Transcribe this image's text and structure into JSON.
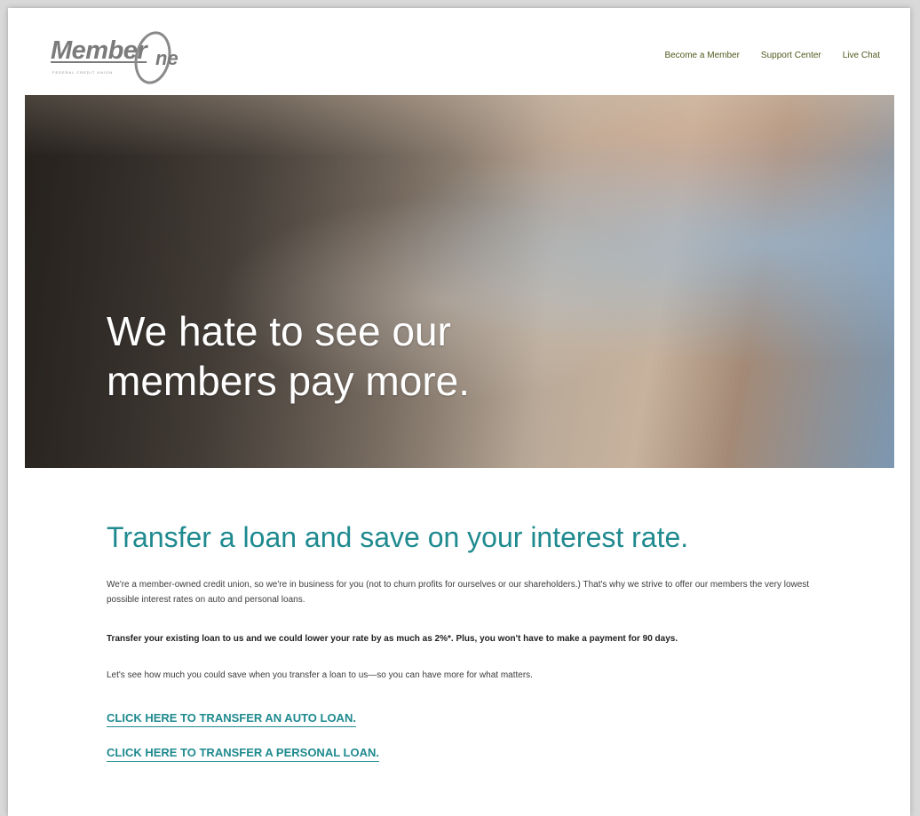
{
  "brand": {
    "logo_word": "Member",
    "logo_one": "ne",
    "logo_sub": "FEDERAL CREDIT UNION"
  },
  "nav": {
    "items": [
      {
        "label": "Become a Member"
      },
      {
        "label": "Support Center"
      },
      {
        "label": "Live Chat"
      }
    ]
  },
  "hero": {
    "headline_line1": "We hate to see our",
    "headline_line2": "members pay more."
  },
  "content": {
    "title": "Transfer a loan and save on your interest rate.",
    "paragraph1": "We're a member-owned credit union, so we're in business for you (not to churn profits for ourselves or our shareholders.) That's why we strive to offer our members the very lowest possible interest rates on auto and personal loans.",
    "paragraph2": "Transfer your existing loan to us and we could lower your rate by as much as 2%*. Plus, you won't have to make a payment for 90 days.",
    "paragraph3": "Let's see how much you could save when you transfer a loan to us—so you can have more for what matters.",
    "cta_auto": "CLICK HERE TO TRANSFER AN AUTO LOAN.",
    "cta_personal": "CLICK HERE TO TRANSFER A PERSONAL LOAN."
  },
  "colors": {
    "teal": "#1f8a8f",
    "nav_text": "#4f5b1e",
    "logo_gray": "#7b7b7b"
  }
}
